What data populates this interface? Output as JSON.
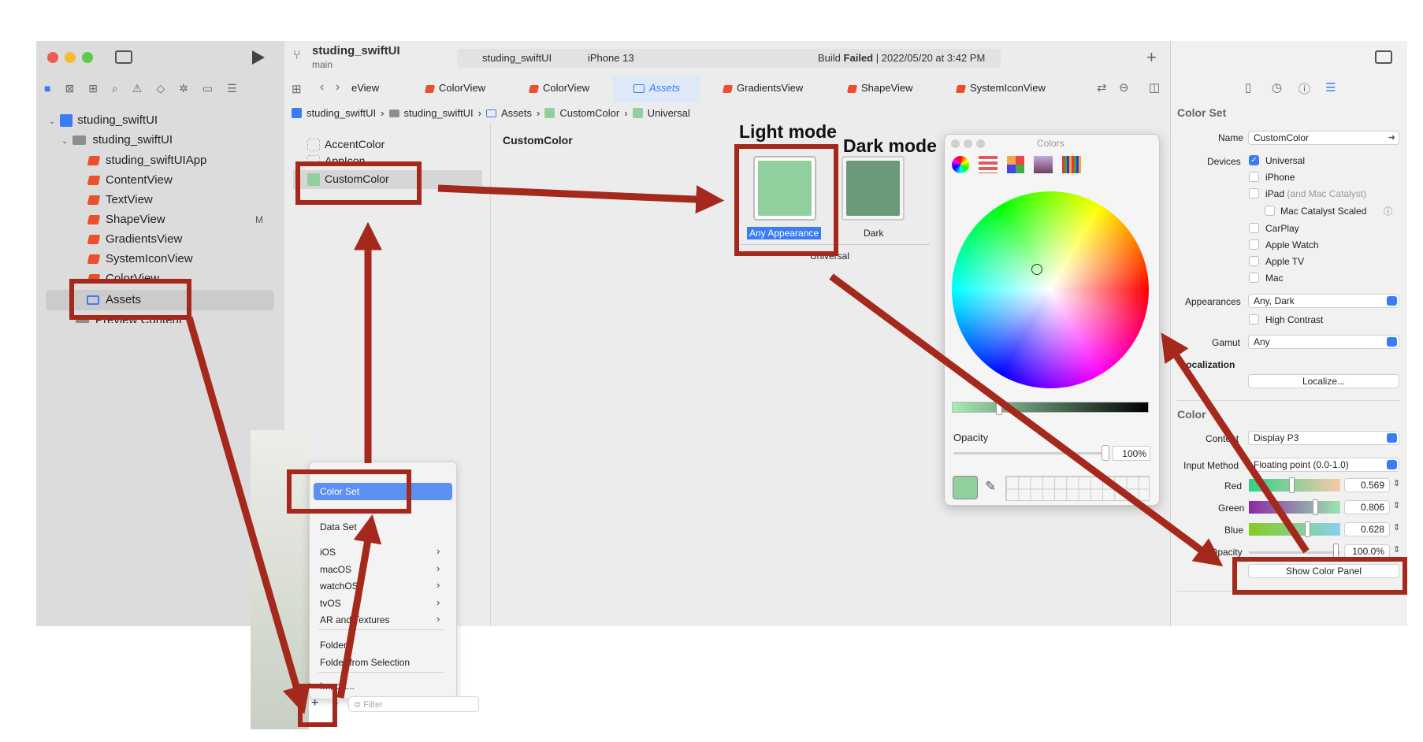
{
  "toolbar": {
    "project": "studing_swiftUI",
    "branch": "main",
    "scheme": "studing_swiftUI",
    "device": "iPhone 13",
    "build_status_prefix": "Build",
    "build_status_word": "Failed",
    "build_status_suffix": "| 2022/05/20 at 3:42 PM"
  },
  "tabs": [
    "eView",
    "ColorView",
    "ColorView",
    "Assets",
    "GradientsView",
    "ShapeView",
    "SystemIconView"
  ],
  "breadcrumb": [
    "studing_swiftUI",
    "studing_swiftUI",
    "Assets",
    "CustomColor",
    "Universal"
  ],
  "navigator": {
    "root": "studing_swiftUI",
    "group": "studing_swiftUI",
    "files": [
      "studing_swiftUIApp",
      "ContentView",
      "TextView",
      "ShapeView",
      "GradientsView",
      "SystemIconView",
      "ColorView"
    ],
    "modified_badge": "M",
    "assets": "Assets",
    "preview": "Preview Content"
  },
  "asset_list": {
    "items": [
      "AccentColor",
      "AppIcon",
      "CustomColor"
    ]
  },
  "editor": {
    "title": "CustomColor",
    "any_label": "Any Appearance",
    "dark_label": "Dark",
    "universal": "Universal"
  },
  "annotations": {
    "light": "Light mode",
    "dark": "Dark mode"
  },
  "colors_panel": {
    "title": "Colors",
    "opacity_label": "Opacity",
    "opacity_value": "100%"
  },
  "add_menu": {
    "items": [
      "Color Set",
      "Data Set",
      "iOS",
      "macOS",
      "watchOS",
      "tvOS",
      "AR and Textures",
      "Folder",
      "Folder from Selection",
      "Import..."
    ],
    "filter": "Filter",
    "plus": "+",
    "minus": "−"
  },
  "inspector": {
    "section_title": "Color Set",
    "name_label": "Name",
    "name_value": "CustomColor",
    "devices_label": "Devices",
    "devices": [
      "Universal",
      "iPhone",
      "iPad",
      "Mac Catalyst Scaled",
      "CarPlay",
      "Apple Watch",
      "Apple TV",
      "Mac"
    ],
    "ipad_note": "(and Mac Catalyst)",
    "appearances_label": "Appearances",
    "appearances_value": "Any, Dark",
    "high_contrast": "High Contrast",
    "gamut_label": "Gamut",
    "gamut_value": "Any",
    "localization_label": "Localization",
    "localize_button": "Localize...",
    "color_section": "Color",
    "content_label": "Content",
    "content_value": "Display P3",
    "input_label": "Input Method",
    "input_value": "Floating point (0.0-1.0)",
    "red_label": "Red",
    "red_value": "0.569",
    "green_label": "Green",
    "green_value": "0.806",
    "blue_label": "Blue",
    "blue_value": "0.628",
    "opacity_label": "Opacity",
    "opacity_value": "100.0%",
    "show_panel": "Show Color Panel"
  },
  "palette": {
    "light": "#91cf9f",
    "dark": "#6b9a7a",
    "accent": "#3a7cf5",
    "arrow": "#a5281c"
  }
}
